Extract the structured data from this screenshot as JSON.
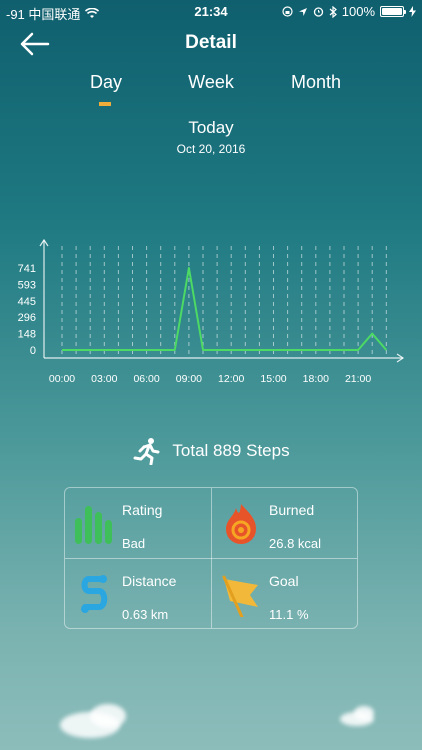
{
  "status_bar": {
    "carrier": "-91 中国联通",
    "time": "21:34",
    "battery": "100%"
  },
  "nav": {
    "title": "Detail"
  },
  "tabs": [
    {
      "label": "Day",
      "selected": true
    },
    {
      "label": "Week",
      "selected": false
    },
    {
      "label": "Month",
      "selected": false
    }
  ],
  "date": {
    "title": "Today",
    "subtitle": "Oct 20, 2016"
  },
  "chart_data": {
    "type": "line",
    "title": "",
    "xlabel": "",
    "ylabel": "",
    "x_ticks": [
      "00:00",
      "03:00",
      "06:00",
      "09:00",
      "12:00",
      "15:00",
      "18:00",
      "21:00"
    ],
    "y_ticks": [
      0,
      148,
      296,
      445,
      593,
      741
    ],
    "ylim": [
      0,
      741
    ],
    "grid": true,
    "x": [
      0,
      1,
      2,
      3,
      4,
      5,
      6,
      7,
      8,
      9,
      10,
      11,
      12,
      13,
      14,
      15,
      16,
      17,
      18,
      19,
      20,
      21,
      22,
      23
    ],
    "series": [
      {
        "values": [
          0,
          0,
          0,
          0,
          0,
          0,
          0,
          0,
          0,
          741,
          0,
          0,
          0,
          0,
          0,
          0,
          0,
          0,
          0,
          0,
          0,
          0,
          148,
          0
        ]
      }
    ],
    "line_color": "#4cd964"
  },
  "total": {
    "label": "Total 889 Steps"
  },
  "stats": {
    "rating": {
      "label": "Rating",
      "value": "Bad"
    },
    "burned": {
      "label": "Burned",
      "value": "26.8 kcal"
    },
    "distance": {
      "label": "Distance",
      "value": "0.63 km"
    },
    "goal": {
      "label": "Goal",
      "value": "11.1 %"
    }
  }
}
